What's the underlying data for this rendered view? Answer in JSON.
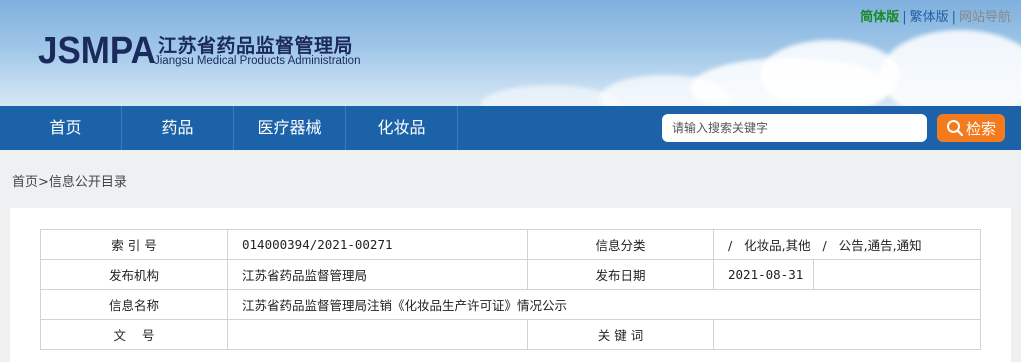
{
  "header": {
    "logo_mark": "JSMPA",
    "logo_cn": "江苏省药品监督管理局",
    "logo_en": "Jiangsu Medical Products Administration",
    "links": {
      "simplified": "简体版",
      "sep": "|",
      "traditional": "繁体版",
      "guide": "网站导航"
    }
  },
  "nav": {
    "items": [
      "首页",
      "药品",
      "医疗器械",
      "化妆品"
    ],
    "search_placeholder": "请输入搜索关键字",
    "search_button": "检索"
  },
  "breadcrumb": "首页>信息公开目录",
  "info_table": {
    "index_label": "索 引 号",
    "index_value": "014000394/2021-00271",
    "category_label": "信息分类",
    "category_value": "/   化妆品,其他   /   公告,通告,通知",
    "publisher_label": "发布机构",
    "publisher_value": "江苏省药品监督管理局",
    "date_label": "发布日期",
    "date_value": "2021-08-31",
    "name_label": "信息名称",
    "name_value": "江苏省药品监督管理局注销《化妆品生产许可证》情况公示",
    "doc_label": "文    号",
    "doc_value": "",
    "keywords_label": "关 键 词",
    "keywords_value": ""
  },
  "colors": {
    "nav_bg": "#1c62a8",
    "search_button": "#f37b1d",
    "simplified_link": "#1a8a2a",
    "traditional_link": "#1f5fa8"
  }
}
